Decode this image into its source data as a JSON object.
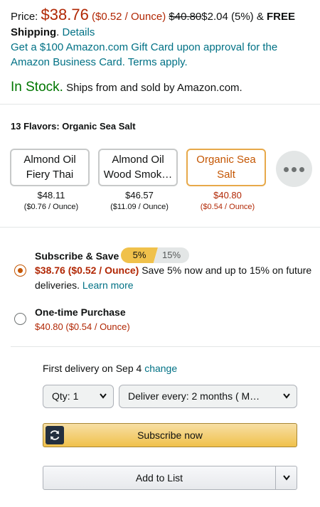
{
  "price": {
    "label": "Price:",
    "amount": "$38.76",
    "per_unit": "($0.52 / Ounce)",
    "list_price": "$40.80",
    "savings": "$2.04 (5%)",
    "free_prefix": "& ",
    "free": "FREE",
    "shipping": "Shipping",
    "details": "Details"
  },
  "gift_card": "Get a $100 Amazon.com Gift Card upon approval for the Amazon Business Card. Terms apply.",
  "stock": {
    "status": "In Stock.",
    "ships": "Ships from and sold by Amazon.com."
  },
  "flavors": {
    "label": "13 Flavors: Organic Sea Salt",
    "options": [
      {
        "line1": "Almond Oil",
        "line2": "Fiery Thai",
        "price": "$48.11",
        "unit": "($0.76 / Ounce)"
      },
      {
        "line1": "Almond Oil",
        "line2": "Wood Smok…",
        "price": "$46.57",
        "unit": "($11.09 / Ounce)"
      },
      {
        "line1": "Organic Sea",
        "line2": "Salt",
        "price": "$40.80",
        "unit": "($0.54 / Ounce)"
      }
    ],
    "selected_index": 2,
    "more_icon": "ellipsis-icon"
  },
  "subscribe": {
    "title": "Subscribe & Save",
    "tier1": "5%",
    "tier2": "15%",
    "price": "$38.76 ($0.52 / Ounce)",
    "desc": "Save 5% now and up to 15% on future",
    "desc2": "deliveries.",
    "learn_more": "Learn more"
  },
  "one_time": {
    "title": "One-time Purchase",
    "price": "$40.80 ($0.54 / Ounce)"
  },
  "delivery": {
    "text": "First delivery on Sep 4",
    "change": "change"
  },
  "qty": {
    "label": "Qty:",
    "value": "1"
  },
  "deliver_every": {
    "label": "Deliver every:",
    "value": "2 months ( M…"
  },
  "buttons": {
    "subscribe_now": "Subscribe now",
    "add_to_list": "Add to List"
  },
  "colors": {
    "price_red": "#b12704",
    "link": "#007185",
    "in_stock": "#007600",
    "selected_border": "#e7a94a",
    "button_yellow": "#f0c14b"
  }
}
